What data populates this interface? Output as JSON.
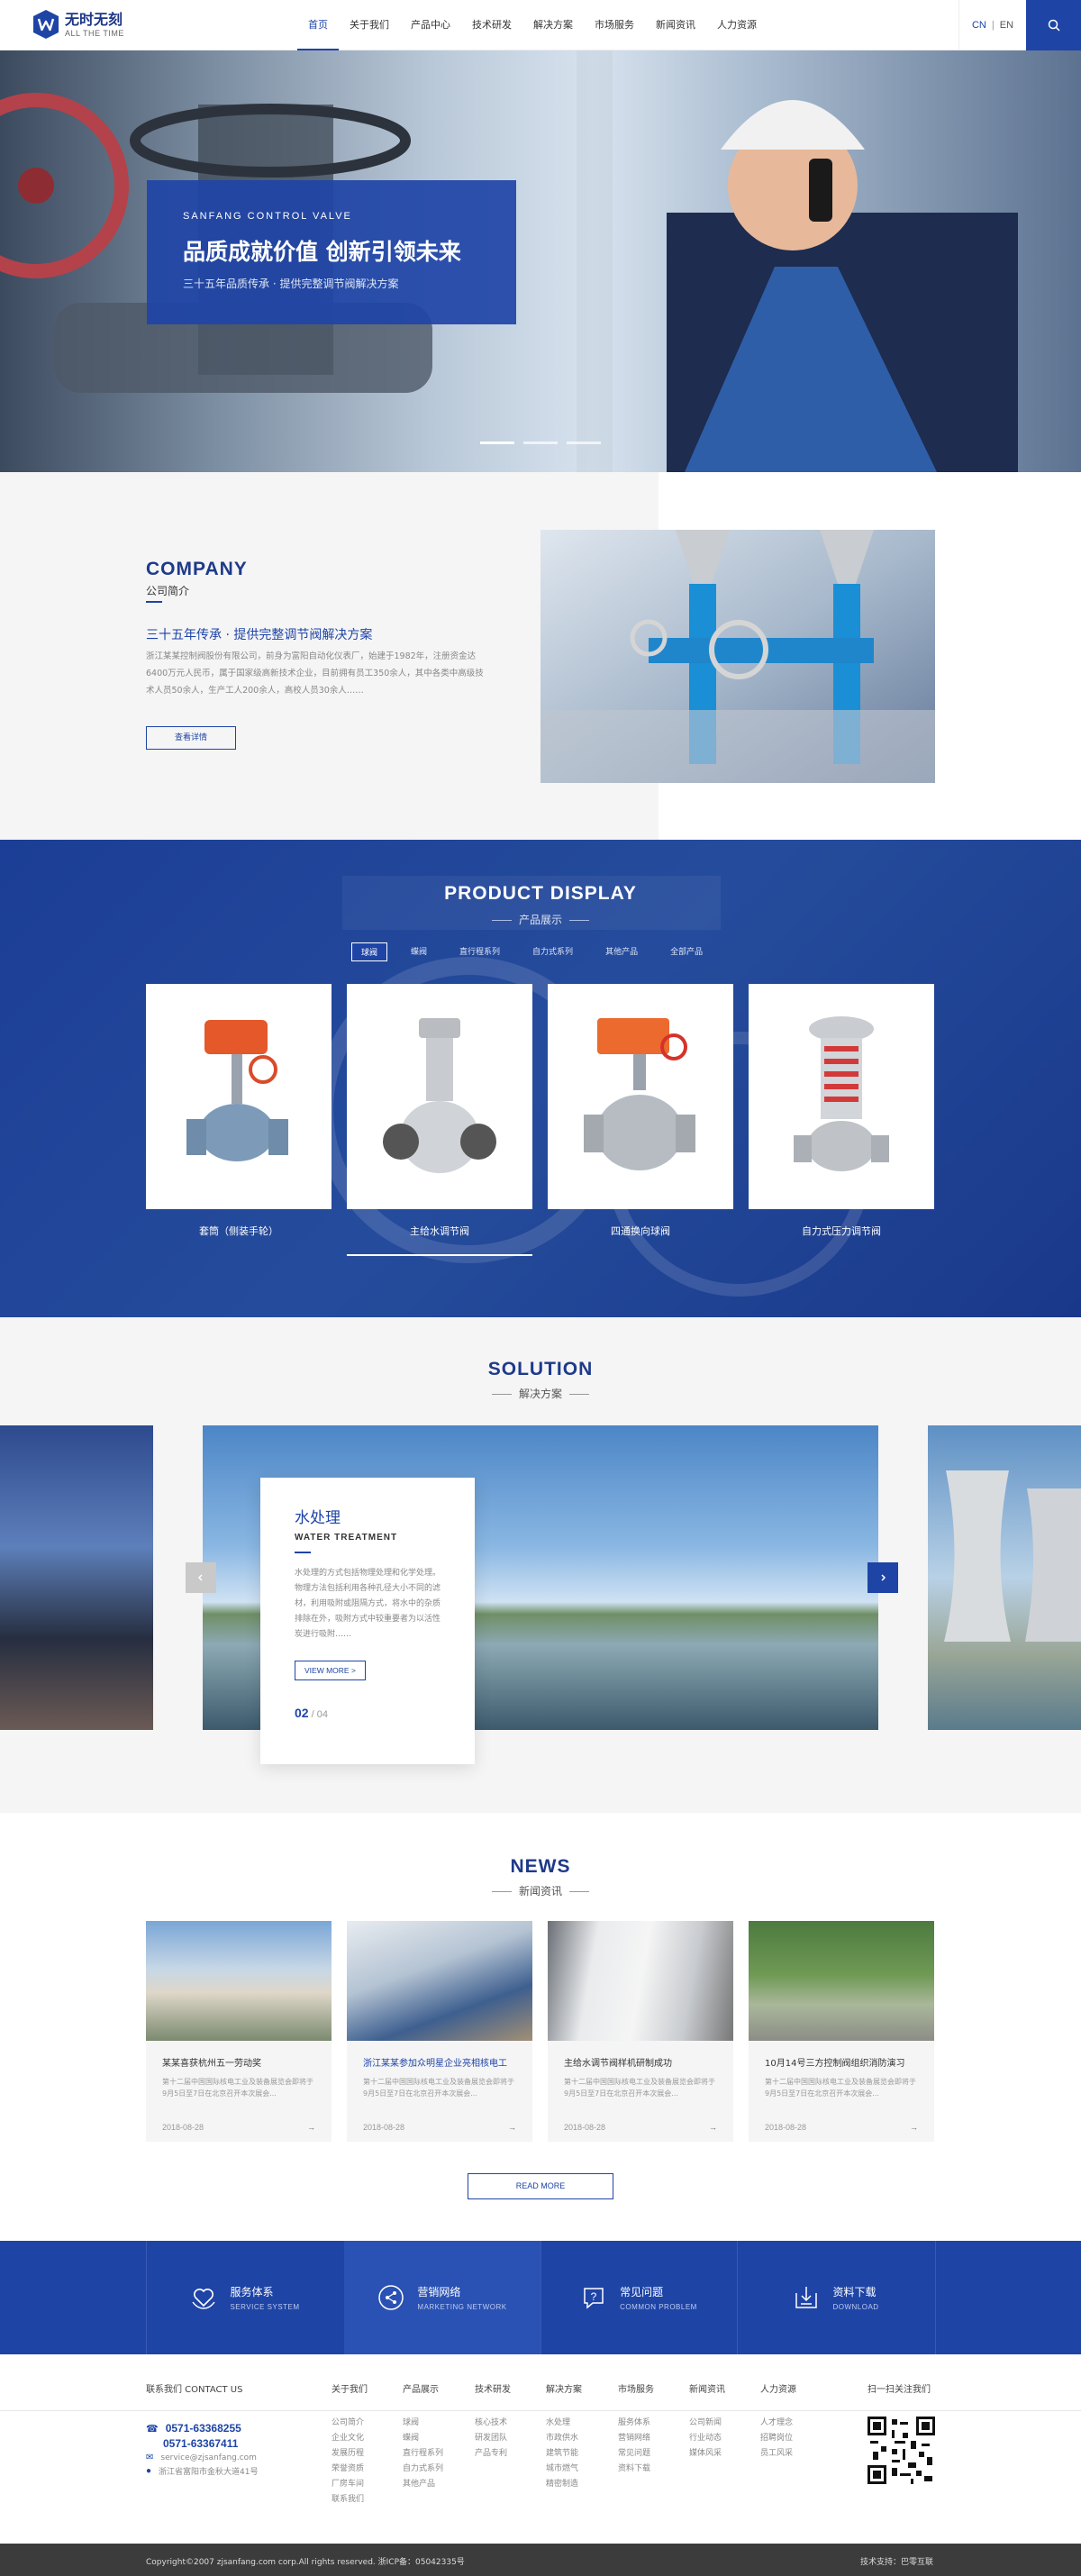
{
  "header": {
    "logo_title": "无时无刻",
    "logo_sub": "ALL THE TIME",
    "nav": [
      "首页",
      "关于我们",
      "产品中心",
      "技术研发",
      "解决方案",
      "市场服务",
      "新闻资讯",
      "人力资源"
    ],
    "lang_cn": "CN",
    "lang_sep": "|",
    "lang_en": "EN"
  },
  "hero": {
    "en": "SANFANG CONTROL VALVE",
    "title": "品质成就价值  创新引领未来",
    "subtitle": "三十五年品质传承 · 提供完整调节阀解决方案",
    "slides_total": 3,
    "active_slide": 1
  },
  "company": {
    "en_title": "COMPANY",
    "cn_title": "公司简介",
    "slogan": "三十五年传承 · 提供完整调节阀解决方案",
    "desc": "浙江某某控制阀股份有限公司，前身为富阳自动化仪表厂，始建于1982年，注册资金达6400万元人民币，属于国家级高新技术企业，目前拥有员工350余人，其中各类中高级技术人员50余人，生产工人200余人，高校人员30余人……",
    "more": "查看详情"
  },
  "products": {
    "en_title": "PRODUCT DISPLAY",
    "cn_title": "产品展示",
    "tabs": [
      "球阀",
      "蝶阀",
      "直行程系列",
      "自力式系列",
      "其他产品",
      "全部产品"
    ],
    "active_tab": 0,
    "items": [
      "套筒（侧装手轮）",
      "主给水调节阀",
      "四通换向球阀",
      "自力式压力调节阀"
    ],
    "active_item": 1
  },
  "solution": {
    "en_title": "SOLUTION",
    "cn_title": "解决方案",
    "card_title": "水处理",
    "card_en": "WATER TREATMENT",
    "card_desc": "水处理的方式包括物理处理和化学处理。物理方法包括利用各种孔径大小不同的滤材，利用吸附或阻隔方式，将水中的杂质排除在外，吸附方式中较重要者为以活性炭进行吸附……",
    "view_more": "VIEW MORE",
    "page_current": "02",
    "page_total": " / 04"
  },
  "news": {
    "en_title": "NEWS",
    "cn_title": "新闻资讯",
    "items": [
      {
        "title": "某某喜获杭州五一劳动奖",
        "desc": "第十二届中国国际核电工业及装备展览会即将于9月5日至7日在北京召开本次展会...",
        "date": "2018-08-28"
      },
      {
        "title": "浙江某某参加众明星企业亮相核电工",
        "desc": "第十二届中国国际核电工业及装备展览会即将于9月5日至7日在北京召开本次展会...",
        "date": "2018-08-28"
      },
      {
        "title": "主给水调节阀样机研制成功",
        "desc": "第十二届中国国际核电工业及装备展览会即将于9月5日至7日在北京召开本次展会...",
        "date": "2018-08-28"
      },
      {
        "title": "10月14号三方控制阀组织消防演习",
        "desc": "第十二届中国国际核电工业及装备展览会即将于9月5日至7日在北京召开本次展会...",
        "date": "2018-08-28"
      }
    ],
    "active_item": 1,
    "arrow": "→",
    "more": "READ MORE"
  },
  "services": [
    {
      "cn": "服务体系",
      "en": "SERVICE SYSTEM",
      "icon": "heart-hands-icon"
    },
    {
      "cn": "营销网络",
      "en": "MARKETING NETWORK",
      "icon": "share-network-icon"
    },
    {
      "cn": "常见问题",
      "en": "COMMON PROBLEM",
      "icon": "question-icon"
    },
    {
      "cn": "资料下载",
      "en": "DOWNLOAD",
      "icon": "download-icon"
    }
  ],
  "footer": {
    "contact_title": "联系我们 CONTACT US",
    "phone1": "0571-63368255",
    "phone2": "0571-63367411",
    "email": "service@zjsanfang.com",
    "address": "浙江省富阳市金秋大道41号",
    "columns": [
      {
        "title": "关于我们",
        "items": [
          "公司简介",
          "企业文化",
          "发展历程",
          "荣誉资质",
          "厂房车间",
          "联系我们"
        ]
      },
      {
        "title": "产品展示",
        "items": [
          "球阀",
          "蝶阀",
          "直行程系列",
          "自力式系列",
          "其他产品"
        ]
      },
      {
        "title": "技术研发",
        "items": [
          "核心技术",
          "研发团队",
          "产品专利"
        ]
      },
      {
        "title": "解决方案",
        "items": [
          "水处理",
          "市政供水",
          "建筑节能",
          "城市燃气",
          "精密制造"
        ]
      },
      {
        "title": "市场服务",
        "items": [
          "服务体系",
          "营销网络",
          "常见问题",
          "资料下载"
        ]
      },
      {
        "title": "新闻资讯",
        "items": [
          "公司新闻",
          "行业动态",
          "媒体风采"
        ]
      },
      {
        "title": "人力资源",
        "items": [
          "人才理念",
          "招聘岗位",
          "员工风采"
        ]
      }
    ],
    "qr_title": "扫一扫关注我们",
    "copyright": "Copyright©2007 zjsanfang.com corp.All rights reserved. 浙ICP备：05042335号",
    "support": "技术支持：巴零互联"
  }
}
